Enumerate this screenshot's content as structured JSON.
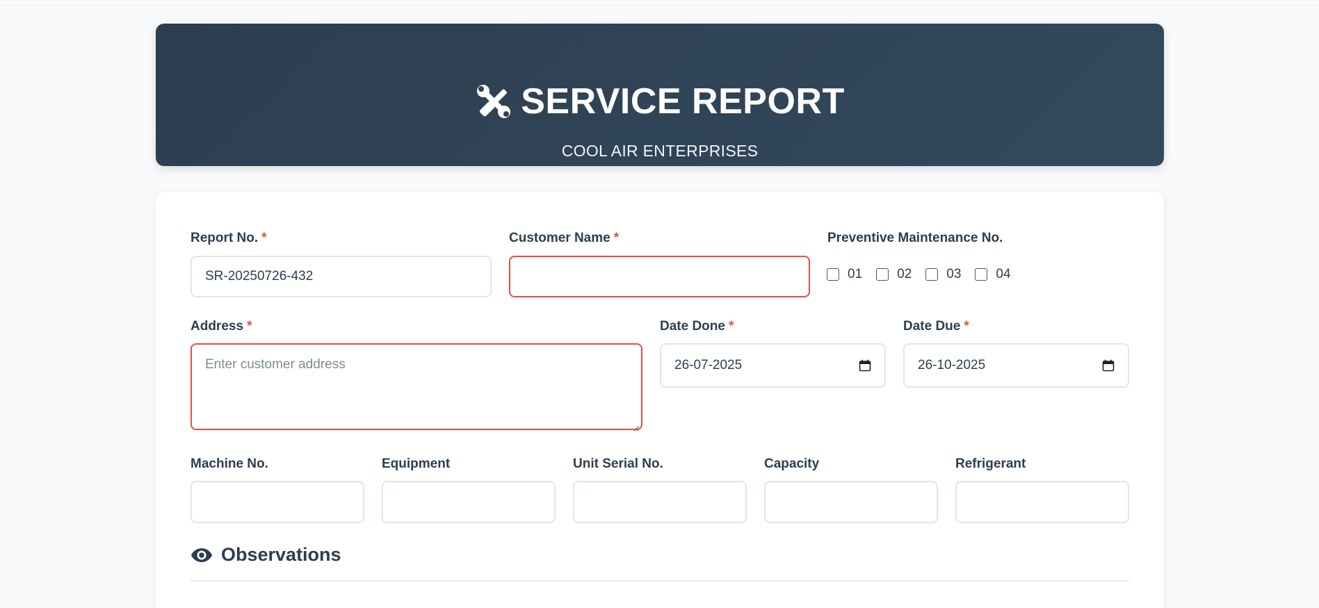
{
  "header": {
    "title": "SERVICE REPORT",
    "company": "COOL AIR ENTERPRISES",
    "icon": "tools-icon"
  },
  "form": {
    "report_no": {
      "label": "Report No.",
      "required": "*",
      "value": "SR-20250726-432"
    },
    "customer_name": {
      "label": "Customer Name",
      "required": "*",
      "value": ""
    },
    "pm_no": {
      "label": "Preventive Maintenance No.",
      "options": [
        "01",
        "02",
        "03",
        "04"
      ]
    },
    "address": {
      "label": "Address",
      "required": "*",
      "placeholder": "Enter customer address"
    },
    "date_done": {
      "label": "Date Done",
      "required": "*",
      "value": "26-07-2025"
    },
    "date_due": {
      "label": "Date Due",
      "required": "*",
      "value": "26-10-2025"
    },
    "machine_no": {
      "label": "Machine No.",
      "value": ""
    },
    "equipment": {
      "label": "Equipment",
      "value": ""
    },
    "unit_serial_no": {
      "label": "Unit Serial No.",
      "value": ""
    },
    "capacity": {
      "label": "Capacity",
      "value": ""
    },
    "refrigerant": {
      "label": "Refrigerant",
      "value": ""
    }
  },
  "observations": {
    "title": "Observations",
    "icon": "eye-icon"
  },
  "colors": {
    "header_bg": "#2c3e50",
    "accent_required": "#e74c3c",
    "text": "#2c3e50",
    "border": "#e1e5ea",
    "page_bg": "#f8f9fa"
  }
}
